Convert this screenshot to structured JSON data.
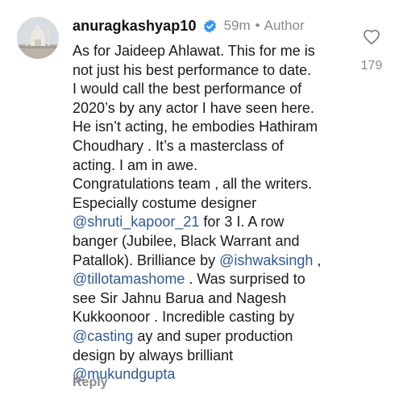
{
  "comment": {
    "username": "anuragkashyap10",
    "time": "59m",
    "separator": "•",
    "role": "Author",
    "like_count": "179",
    "reply_label": "Reply",
    "lines": [
      [
        {
          "t": "As for Jaideep Ahlawat. This for me is"
        }
      ],
      [
        {
          "t": "not just his best performance to date."
        }
      ],
      [
        {
          "t": "I would call the best performance of"
        }
      ],
      [
        {
          "t": "2020’s by any actor I have seen here."
        }
      ],
      [
        {
          "t": "He isn’t acting, he embodies Hathiram"
        }
      ],
      [
        {
          "t": "Choudhary . It’s a masterclass of"
        }
      ],
      [
        {
          "t": "acting. I am in awe."
        }
      ],
      [
        {
          "t": "Congratulations team , all the writers."
        }
      ],
      [
        {
          "t": "Especially  costume designer"
        }
      ],
      [
        {
          "t": "@shruti_kapoor_21",
          "m": true
        },
        {
          "t": " for 3 I. A row"
        }
      ],
      [
        {
          "t": "banger (Jubilee, Black Warrant and"
        }
      ],
      [
        {
          "t": "Patallok). Brilliance by "
        },
        {
          "t": "@ishwaksingh",
          "m": true
        },
        {
          "t": " ,"
        }
      ],
      [
        {
          "t": "@tillotamashome",
          "m": true
        },
        {
          "t": " . Was surprised to"
        }
      ],
      [
        {
          "t": "see Sir Jahnu Barua and Nagesh"
        }
      ],
      [
        {
          "t": "Kukkoonoor . Incredible casting by"
        }
      ],
      [
        {
          "t": "@casting",
          "m": true
        },
        {
          "t": " ay and super production"
        }
      ],
      [
        {
          "t": "design by always brilliant"
        }
      ],
      [
        {
          "t": "@mukundgupta",
          "m": true
        }
      ]
    ]
  },
  "colors": {
    "mention": "#2f5a92",
    "verified_badge": "#3897f0",
    "muted_text": "#8a8a8a"
  },
  "icons": {
    "verified": "verified-badge-icon",
    "like": "heart-outline-icon"
  }
}
